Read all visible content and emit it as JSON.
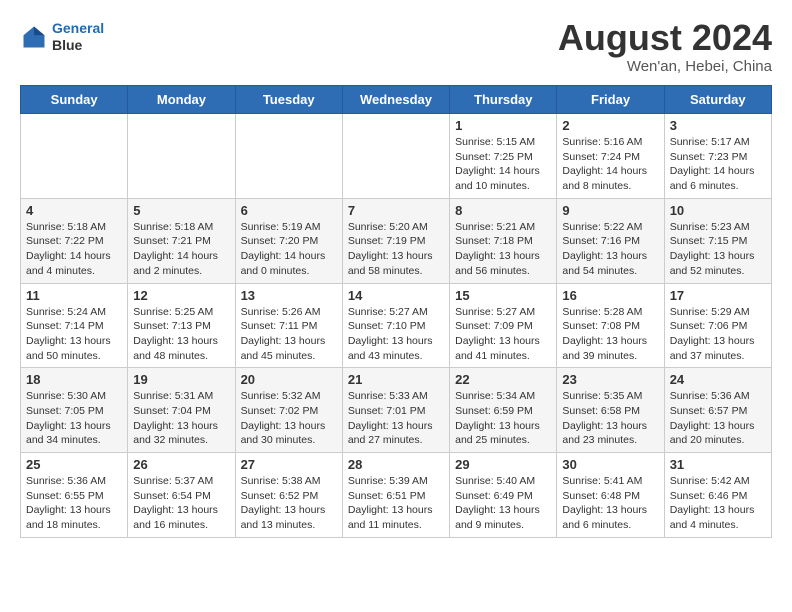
{
  "header": {
    "logo_line1": "General",
    "logo_line2": "Blue",
    "month_year": "August 2024",
    "location": "Wen'an, Hebei, China"
  },
  "days_of_week": [
    "Sunday",
    "Monday",
    "Tuesday",
    "Wednesday",
    "Thursday",
    "Friday",
    "Saturday"
  ],
  "weeks": [
    [
      {
        "day": "",
        "info": ""
      },
      {
        "day": "",
        "info": ""
      },
      {
        "day": "",
        "info": ""
      },
      {
        "day": "",
        "info": ""
      },
      {
        "day": "1",
        "info": "Sunrise: 5:15 AM\nSunset: 7:25 PM\nDaylight: 14 hours\nand 10 minutes."
      },
      {
        "day": "2",
        "info": "Sunrise: 5:16 AM\nSunset: 7:24 PM\nDaylight: 14 hours\nand 8 minutes."
      },
      {
        "day": "3",
        "info": "Sunrise: 5:17 AM\nSunset: 7:23 PM\nDaylight: 14 hours\nand 6 minutes."
      }
    ],
    [
      {
        "day": "4",
        "info": "Sunrise: 5:18 AM\nSunset: 7:22 PM\nDaylight: 14 hours\nand 4 minutes."
      },
      {
        "day": "5",
        "info": "Sunrise: 5:18 AM\nSunset: 7:21 PM\nDaylight: 14 hours\nand 2 minutes."
      },
      {
        "day": "6",
        "info": "Sunrise: 5:19 AM\nSunset: 7:20 PM\nDaylight: 14 hours\nand 0 minutes."
      },
      {
        "day": "7",
        "info": "Sunrise: 5:20 AM\nSunset: 7:19 PM\nDaylight: 13 hours\nand 58 minutes."
      },
      {
        "day": "8",
        "info": "Sunrise: 5:21 AM\nSunset: 7:18 PM\nDaylight: 13 hours\nand 56 minutes."
      },
      {
        "day": "9",
        "info": "Sunrise: 5:22 AM\nSunset: 7:16 PM\nDaylight: 13 hours\nand 54 minutes."
      },
      {
        "day": "10",
        "info": "Sunrise: 5:23 AM\nSunset: 7:15 PM\nDaylight: 13 hours\nand 52 minutes."
      }
    ],
    [
      {
        "day": "11",
        "info": "Sunrise: 5:24 AM\nSunset: 7:14 PM\nDaylight: 13 hours\nand 50 minutes."
      },
      {
        "day": "12",
        "info": "Sunrise: 5:25 AM\nSunset: 7:13 PM\nDaylight: 13 hours\nand 48 minutes."
      },
      {
        "day": "13",
        "info": "Sunrise: 5:26 AM\nSunset: 7:11 PM\nDaylight: 13 hours\nand 45 minutes."
      },
      {
        "day": "14",
        "info": "Sunrise: 5:27 AM\nSunset: 7:10 PM\nDaylight: 13 hours\nand 43 minutes."
      },
      {
        "day": "15",
        "info": "Sunrise: 5:27 AM\nSunset: 7:09 PM\nDaylight: 13 hours\nand 41 minutes."
      },
      {
        "day": "16",
        "info": "Sunrise: 5:28 AM\nSunset: 7:08 PM\nDaylight: 13 hours\nand 39 minutes."
      },
      {
        "day": "17",
        "info": "Sunrise: 5:29 AM\nSunset: 7:06 PM\nDaylight: 13 hours\nand 37 minutes."
      }
    ],
    [
      {
        "day": "18",
        "info": "Sunrise: 5:30 AM\nSunset: 7:05 PM\nDaylight: 13 hours\nand 34 minutes."
      },
      {
        "day": "19",
        "info": "Sunrise: 5:31 AM\nSunset: 7:04 PM\nDaylight: 13 hours\nand 32 minutes."
      },
      {
        "day": "20",
        "info": "Sunrise: 5:32 AM\nSunset: 7:02 PM\nDaylight: 13 hours\nand 30 minutes."
      },
      {
        "day": "21",
        "info": "Sunrise: 5:33 AM\nSunset: 7:01 PM\nDaylight: 13 hours\nand 27 minutes."
      },
      {
        "day": "22",
        "info": "Sunrise: 5:34 AM\nSunset: 6:59 PM\nDaylight: 13 hours\nand 25 minutes."
      },
      {
        "day": "23",
        "info": "Sunrise: 5:35 AM\nSunset: 6:58 PM\nDaylight: 13 hours\nand 23 minutes."
      },
      {
        "day": "24",
        "info": "Sunrise: 5:36 AM\nSunset: 6:57 PM\nDaylight: 13 hours\nand 20 minutes."
      }
    ],
    [
      {
        "day": "25",
        "info": "Sunrise: 5:36 AM\nSunset: 6:55 PM\nDaylight: 13 hours\nand 18 minutes."
      },
      {
        "day": "26",
        "info": "Sunrise: 5:37 AM\nSunset: 6:54 PM\nDaylight: 13 hours\nand 16 minutes."
      },
      {
        "day": "27",
        "info": "Sunrise: 5:38 AM\nSunset: 6:52 PM\nDaylight: 13 hours\nand 13 minutes."
      },
      {
        "day": "28",
        "info": "Sunrise: 5:39 AM\nSunset: 6:51 PM\nDaylight: 13 hours\nand 11 minutes."
      },
      {
        "day": "29",
        "info": "Sunrise: 5:40 AM\nSunset: 6:49 PM\nDaylight: 13 hours\nand 9 minutes."
      },
      {
        "day": "30",
        "info": "Sunrise: 5:41 AM\nSunset: 6:48 PM\nDaylight: 13 hours\nand 6 minutes."
      },
      {
        "day": "31",
        "info": "Sunrise: 5:42 AM\nSunset: 6:46 PM\nDaylight: 13 hours\nand 4 minutes."
      }
    ]
  ]
}
